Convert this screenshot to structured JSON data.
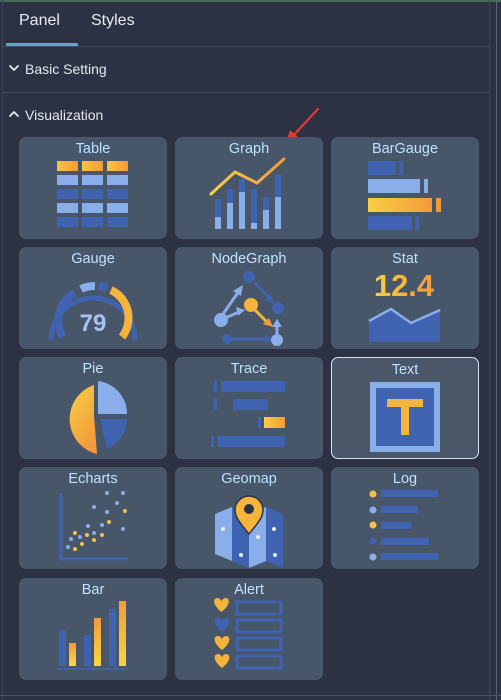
{
  "tabs": [
    {
      "label": "Panel",
      "active": true
    },
    {
      "label": "Styles",
      "active": false
    }
  ],
  "sections": {
    "basic": {
      "label": "Basic Setting",
      "expanded": false
    },
    "visualization": {
      "label": "Visualization",
      "expanded": true
    }
  },
  "colors": {
    "accent": "#5fa8c8",
    "card_bg": "#48566a",
    "title_text": "#bfe3ff",
    "blue_dark": "#3f63b0",
    "blue_light": "#8aaeea",
    "orange": "#f5b43c",
    "annotation_red": "#e53a2c"
  },
  "visualizations": [
    {
      "label": "Table",
      "icon": "table-icon",
      "selected": false
    },
    {
      "label": "Graph",
      "icon": "graph-icon",
      "selected": false
    },
    {
      "label": "BarGauge",
      "icon": "bargauge-icon",
      "selected": false
    },
    {
      "label": "Gauge",
      "icon": "gauge-icon",
      "selected": false,
      "icon_value": "79"
    },
    {
      "label": "NodeGraph",
      "icon": "nodegraph-icon",
      "selected": false
    },
    {
      "label": "Stat",
      "icon": "stat-icon",
      "selected": false,
      "icon_value": "12.4"
    },
    {
      "label": "Pie",
      "icon": "pie-icon",
      "selected": false
    },
    {
      "label": "Trace",
      "icon": "trace-icon",
      "selected": false
    },
    {
      "label": "Text",
      "icon": "text-icon",
      "selected": true,
      "icon_value": "T"
    },
    {
      "label": "Echarts",
      "icon": "echarts-icon",
      "selected": false
    },
    {
      "label": "Geomap",
      "icon": "geomap-icon",
      "selected": false
    },
    {
      "label": "Log",
      "icon": "log-icon",
      "selected": false
    },
    {
      "label": "Bar",
      "icon": "bar-icon",
      "selected": false
    },
    {
      "label": "Alert",
      "icon": "alert-icon",
      "selected": false
    }
  ]
}
